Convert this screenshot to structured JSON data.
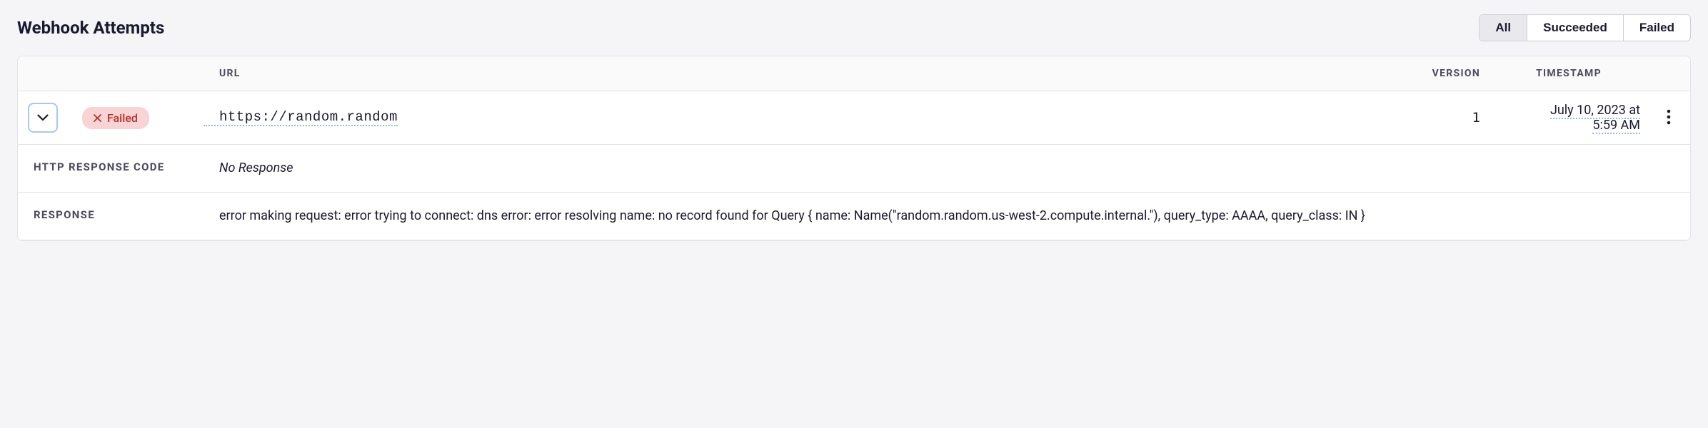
{
  "page": {
    "title": "Webhook Attempts"
  },
  "filters": {
    "all": "All",
    "succeeded": "Succeeded",
    "failed": "Failed"
  },
  "columns": {
    "url": "URL",
    "version": "VERSION",
    "timestamp": "TIMESTAMP"
  },
  "attempts": [
    {
      "status": "Failed",
      "url": "https://random.random",
      "version": "1",
      "timestamp_line1": "July 10, 2023 at",
      "timestamp_line2": "5:59 AM"
    }
  ],
  "details": {
    "http_response_code_label": "HTTP RESPONSE CODE",
    "http_response_code_value": "No Response",
    "response_label": "RESPONSE",
    "response_value": "error making request: error trying to connect: dns error: error resolving name: no record found for Query { name: Name(\"random.random.us-west-2.compute.internal.\"), query_type: AAAA, query_class: IN }"
  }
}
